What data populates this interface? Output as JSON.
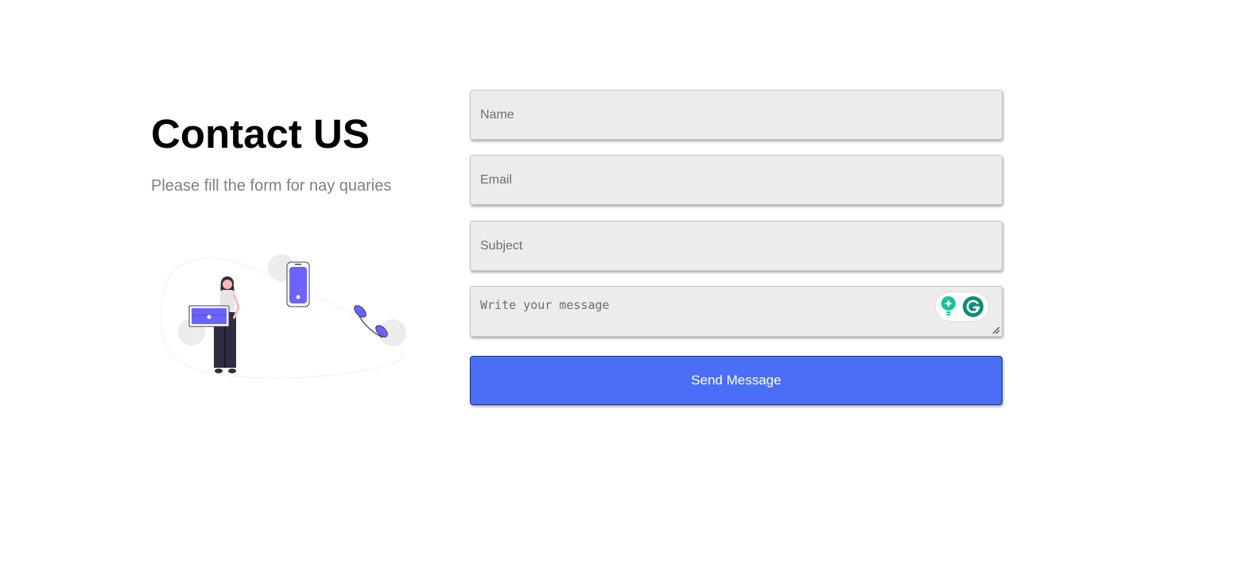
{
  "header": {
    "title": "Contact US",
    "subtitle": "Please fill the form for nay quaries"
  },
  "illustration": {
    "icon": "contact-illustration",
    "accent_color": "#6c63ff"
  },
  "form": {
    "name_placeholder": "Name",
    "email_placeholder": "Email",
    "subject_placeholder": "Subject",
    "message_placeholder": "Write your message",
    "submit_label": "Send Message"
  },
  "extensions": {
    "grammarly_icons": [
      "grammarly-suggestion-icon",
      "grammarly-logo-icon"
    ],
    "grammarly_color": "#15c39a"
  },
  "colors": {
    "button": "#4a6ff6",
    "field_bg": "#ececec",
    "subtitle": "#808080"
  }
}
